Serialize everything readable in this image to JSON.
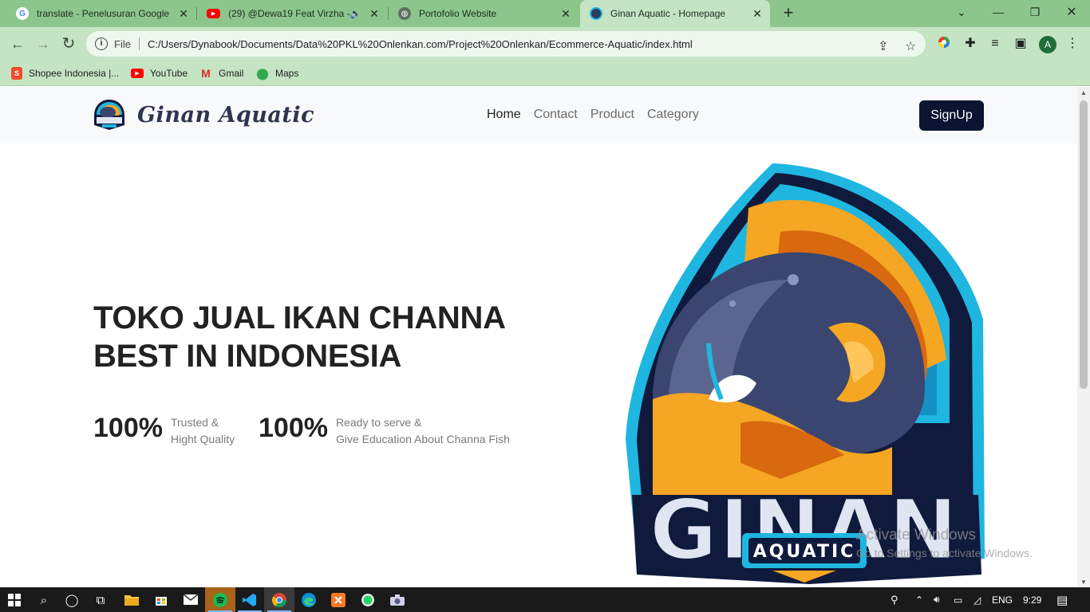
{
  "browser": {
    "tabs": [
      {
        "title": "translate - Penelusuran Google",
        "favicon": "google-icon"
      },
      {
        "title": "(29) @Dewa19 Feat Virzha - ",
        "favicon": "youtube-icon",
        "audio": true
      },
      {
        "title": "Portofolio Website",
        "favicon": "globe-icon"
      },
      {
        "title": "Ginan Aquatic - Homepage",
        "favicon": "ginan-icon",
        "active": true
      }
    ],
    "address": {
      "scheme": "File",
      "url": "C:/Users/Dynabook/Documents/Data%20PKL%20Onlenkan.com/Project%20Onlenkan/Ecommerce-Aquatic/index.html"
    },
    "profile_initial": "A",
    "bookmarks": [
      {
        "label": "Shopee Indonesia |...",
        "icon": "shopee-icon"
      },
      {
        "label": "YouTube",
        "icon": "youtube-icon"
      },
      {
        "label": "Gmail",
        "icon": "gmail-icon"
      },
      {
        "label": "Maps",
        "icon": "maps-icon"
      }
    ]
  },
  "site": {
    "brand": "Ginan Aquatic",
    "nav": [
      "Home",
      "Contact",
      "Product",
      "Category"
    ],
    "signup": "SignUp",
    "hero": {
      "title_line1": "TOKO JUAL IKAN CHANNA",
      "title_line2": "BEST IN INDONESIA",
      "stats": [
        {
          "value": "100%",
          "line1": "Trusted &",
          "line2": "Hight Quality"
        },
        {
          "value": "100%",
          "line1": "Ready to serve &",
          "line2": "Give Education About Channa Fish"
        }
      ]
    },
    "logo_text": {
      "main": "GINAN",
      "sub": "AQUATIC"
    }
  },
  "watermark": {
    "line1": "Activate Windows",
    "line2": "Go to Settings to activate Windows."
  },
  "taskbar": {
    "language": "ENG",
    "time": "9:29"
  },
  "colors": {
    "tab_strip": "#8cc68c",
    "toolbar": "#c4e4c4",
    "signup_bg": "#0b1430",
    "logo_navy": "#0f1a3c",
    "logo_cyan": "#1fb6e0",
    "logo_orange": "#f5a623"
  }
}
